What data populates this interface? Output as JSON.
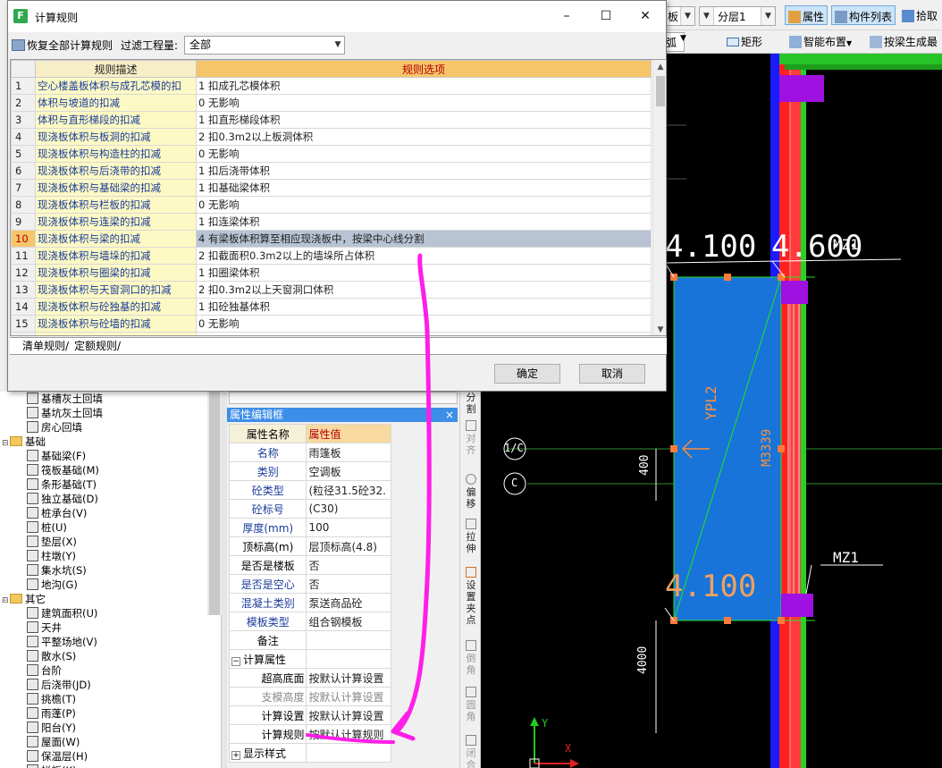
{
  "main_toolbar": {
    "combo1": "板",
    "combo2": "分层1",
    "attr_btn": "属性",
    "comp_list_btn": "构件列表",
    "pick_btn": "拾取",
    "combo3": "弧",
    "rect_btn": "矩形",
    "smart_place_btn": "智能布置",
    "beam_gen_btn": "按梁生成最"
  },
  "left_tree": {
    "items": [
      {
        "label": "基槽灰土回填",
        "level": 2
      },
      {
        "label": "基坑灰土回填",
        "level": 2
      },
      {
        "label": "房心回填",
        "level": 2
      },
      {
        "label": "基础",
        "level": 1,
        "folder": true
      },
      {
        "label": "基础梁(F)",
        "level": 2
      },
      {
        "label": "筏板基础(M)",
        "level": 2
      },
      {
        "label": "条形基础(T)",
        "level": 2
      },
      {
        "label": "独立基础(D)",
        "level": 2
      },
      {
        "label": "桩承台(V)",
        "level": 2
      },
      {
        "label": "桩(U)",
        "level": 2
      },
      {
        "label": "垫层(X)",
        "level": 2
      },
      {
        "label": "柱墩(Y)",
        "level": 2
      },
      {
        "label": "集水坑(S)",
        "level": 2
      },
      {
        "label": "地沟(G)",
        "level": 2
      },
      {
        "label": "其它",
        "level": 1,
        "folder": true
      },
      {
        "label": "建筑面积(U)",
        "level": 2
      },
      {
        "label": "天井",
        "level": 2
      },
      {
        "label": "平整场地(V)",
        "level": 2
      },
      {
        "label": "散水(S)",
        "level": 2
      },
      {
        "label": "台阶",
        "level": 2
      },
      {
        "label": "后浇带(JD)",
        "level": 2
      },
      {
        "label": "挑檐(T)",
        "level": 2
      },
      {
        "label": "雨蓬(P)",
        "level": 2
      },
      {
        "label": "阳台(Y)",
        "level": 2
      },
      {
        "label": "屋面(W)",
        "level": 2
      },
      {
        "label": "保温层(H)",
        "level": 2
      },
      {
        "label": "栏板(K)",
        "level": 2
      }
    ]
  },
  "property_panel": {
    "title": "属性编辑框",
    "close": "×",
    "col_name": "属性名称",
    "col_value": "属性值",
    "rows": [
      {
        "name": "名称",
        "value": "雨篷板"
      },
      {
        "name": "类别",
        "value": "空调板"
      },
      {
        "name": "砼类型",
        "value": "(粒径31.5砼32."
      },
      {
        "name": "砼标号",
        "value": "(C30)"
      },
      {
        "name": "厚度(mm)",
        "value": "100"
      },
      {
        "name": "顶标高(m)",
        "value": "层顶标高(4.8)"
      },
      {
        "name": "是否是楼板",
        "value": "否"
      },
      {
        "name": "是否是空心",
        "value": "否"
      },
      {
        "name": "混凝土类别",
        "value": "泵送商品砼"
      },
      {
        "name": "模板类型",
        "value": "组合钢模板"
      },
      {
        "name": "备注",
        "value": ""
      }
    ],
    "group_calc": "计算属性",
    "calc_rows": [
      {
        "name": "超高底面",
        "value": "按默认计算设置"
      },
      {
        "name": "支模高度",
        "value": "按默认计算设置"
      },
      {
        "name": "计算设置",
        "value": "按默认计算设置"
      },
      {
        "name": "计算规则",
        "value": "按默认计算规则"
      }
    ],
    "group_display": "显示样式"
  },
  "vertical_toolbar": {
    "split": "分割",
    "align": "对齐",
    "offset": "偏移",
    "stretch": "拉伸",
    "set_point": "设置夹点",
    "chamfer": "倒角",
    "fillet": "圆角",
    "close": "闭合"
  },
  "cad": {
    "label_4100_top": "4.100",
    "label_4600": "4.600",
    "label_4100_bottom": "4.100",
    "label_mz1_top": "MZ1",
    "label_mz1_bottom": "MZ1",
    "label_ypl2": "YPL2",
    "label_m3339": "M3339",
    "label_400": "400",
    "label_4000": "4000",
    "axis_1c": "1/C",
    "axis_c": "C",
    "axis_x": "X",
    "axis_y": "Y"
  },
  "dialog": {
    "title": "计算规则",
    "restore_label": "恢复全部计算规则",
    "filter_label": "过滤工程量:",
    "filter_value": "全部",
    "col_desc": "规则描述",
    "col_opt": "规则选项",
    "rows": [
      {
        "idx": "1",
        "desc": "空心楼盖板体积与成孔芯模的扣",
        "opt": "1 扣成孔芯模体积"
      },
      {
        "idx": "2",
        "desc": "体积与坡道的扣减",
        "opt": "0 无影响"
      },
      {
        "idx": "3",
        "desc": "体积与直形梯段的扣减",
        "opt": "1 扣直形梯段体积"
      },
      {
        "idx": "4",
        "desc": "现浇板体积与板洞的扣减",
        "opt": "2  扣0.3m2以上板洞体积"
      },
      {
        "idx": "5",
        "desc": "现浇板体积与构造柱的扣减",
        "opt": "0 无影响"
      },
      {
        "idx": "6",
        "desc": "现浇板体积与后浇带的扣减",
        "opt": "1  扣后浇带体积"
      },
      {
        "idx": "7",
        "desc": "现浇板体积与基础梁的扣减",
        "opt": "1  扣基础梁体积"
      },
      {
        "idx": "8",
        "desc": "现浇板体积与栏板的扣减",
        "opt": "0 无影响"
      },
      {
        "idx": "9",
        "desc": "现浇板体积与连梁的扣减",
        "opt": "1  扣连梁体积"
      },
      {
        "idx": "10",
        "desc": "现浇板体积与梁的扣减",
        "opt": "4  有梁板体积算至相应现浇板中，按梁中心线分割",
        "selected": true
      },
      {
        "idx": "11",
        "desc": "现浇板体积与墙垛的扣减",
        "opt": "2 扣截面积0.3m2以上的墙垛所占体积"
      },
      {
        "idx": "12",
        "desc": "现浇板体积与圈梁的扣减",
        "opt": "1  扣圈梁体积"
      },
      {
        "idx": "13",
        "desc": "现浇板体积与天窗洞口的扣减",
        "opt": "2  扣0.3m2以上天窗洞口体积"
      },
      {
        "idx": "14",
        "desc": "现浇板体积与砼独基的扣减",
        "opt": "1  扣砼独基体积"
      },
      {
        "idx": "15",
        "desc": "现浇板体积与砼墙的扣减",
        "opt": "0 无影响"
      }
    ],
    "tab_qd": "清单规则",
    "tab_de": "定额规则",
    "ok": "确定",
    "cancel": "取消"
  },
  "colors": {
    "annotation": "#ff1ee8",
    "selection": "#b8c3d3",
    "header_accent": "#f6c56a",
    "panel_title": "#3d8ee8"
  }
}
